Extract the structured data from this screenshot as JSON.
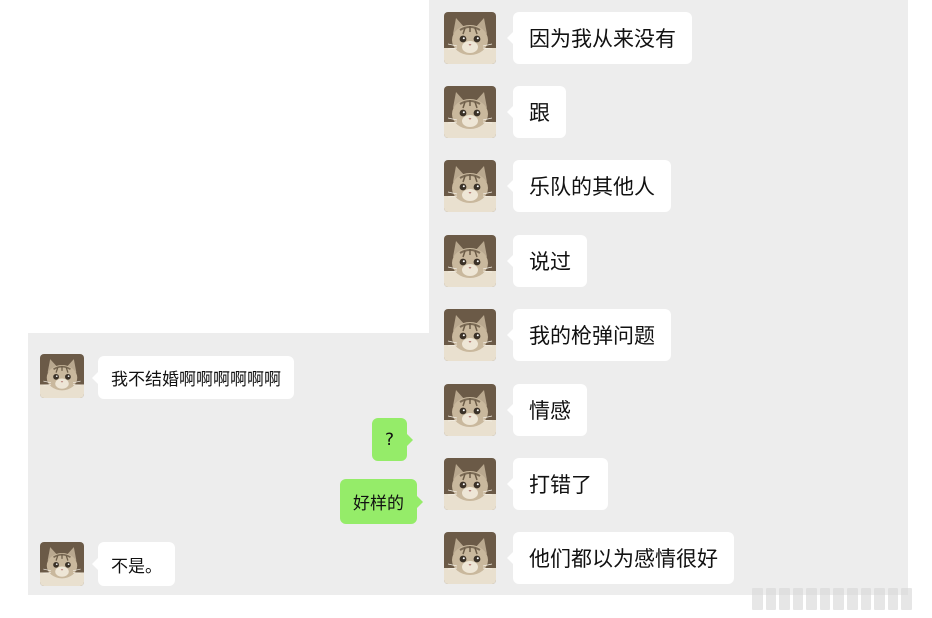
{
  "left_chat": {
    "messages": [
      {
        "sender": "cat",
        "text": "我不结婚啊啊啊啊啊啊"
      },
      {
        "sender": "self",
        "text": "?"
      },
      {
        "sender": "self",
        "text": "好样的"
      },
      {
        "sender": "cat",
        "text": "不是。"
      }
    ]
  },
  "right_chat": {
    "messages": [
      {
        "sender": "cat",
        "text": "因为我从来没有"
      },
      {
        "sender": "cat",
        "text": "跟"
      },
      {
        "sender": "cat",
        "text": "乐队的其他人"
      },
      {
        "sender": "cat",
        "text": "说过"
      },
      {
        "sender": "cat",
        "text": "我的枪弹问题"
      },
      {
        "sender": "cat",
        "text": "情感"
      },
      {
        "sender": "cat",
        "text": "打错了"
      },
      {
        "sender": "cat",
        "text": "他们都以为感情很好"
      }
    ]
  },
  "colors": {
    "chat_background": "#ededed",
    "incoming_bubble": "#ffffff",
    "outgoing_bubble": "#95ec69"
  },
  "icons": {
    "avatar": "cat-avatar-icon"
  }
}
